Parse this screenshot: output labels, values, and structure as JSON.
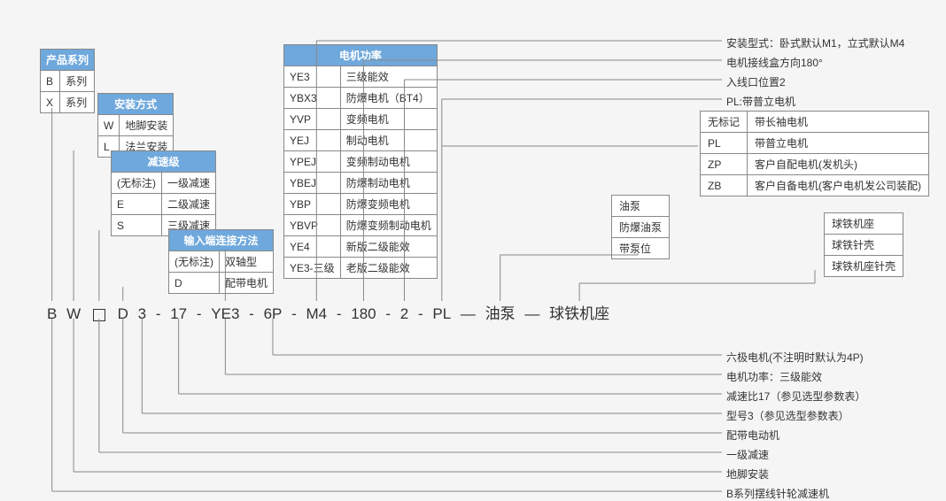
{
  "tables": {
    "series": {
      "title": "产品系列",
      "rows": [
        [
          "B",
          "系列"
        ],
        [
          "X",
          "系列"
        ]
      ]
    },
    "mount": {
      "title": "安装方式",
      "rows": [
        [
          "W",
          "地脚安装"
        ],
        [
          "L",
          "法兰安装"
        ]
      ]
    },
    "reduction": {
      "title": "减速级",
      "rows": [
        [
          "(无标注)",
          "一级减速"
        ],
        [
          "E",
          "二级减速"
        ],
        [
          "S",
          "三级减速"
        ]
      ]
    },
    "input": {
      "title": "输入端连接方法",
      "rows": [
        [
          "(无标注)",
          "双轴型"
        ],
        [
          "D",
          "配带电机"
        ]
      ]
    },
    "motor": {
      "title": "电机功率",
      "rows": [
        [
          "YE3",
          "三级能效"
        ],
        [
          "YBX3",
          "防爆电机（BT4）"
        ],
        [
          "YVP",
          "变频电机"
        ],
        [
          "YEJ",
          "制动电机"
        ],
        [
          "YPEJ",
          "变频制动电机"
        ],
        [
          "YBEJ",
          "防爆制动电机"
        ],
        [
          "YBP",
          "防爆变频电机"
        ],
        [
          "YBVP",
          "防爆变频制动电机"
        ],
        [
          "YE4",
          "新版二级能效"
        ],
        [
          "YE3-三级",
          "老版二级能效"
        ]
      ]
    },
    "motor_mark": {
      "rows": [
        [
          "无标记",
          "带长袖电机"
        ],
        [
          "PL",
          "带普立电机"
        ],
        [
          "ZP",
          "客户自配电机(发机头)"
        ],
        [
          "ZB",
          "客户自备电机(客户电机发公司装配)"
        ]
      ]
    },
    "pump": {
      "rows": [
        [
          "油泵"
        ],
        [
          "防爆油泵"
        ],
        [
          "带泵位"
        ]
      ]
    },
    "iron": {
      "rows": [
        [
          "球铁机座"
        ],
        [
          "球铁针壳"
        ],
        [
          "球铁机座针壳"
        ]
      ]
    }
  },
  "top_notes": [
    "安装型式：卧式默认M1，立式默认M4",
    "电机接线盒方向180°",
    "入线口位置2",
    "PL:带普立电机"
  ],
  "bottom_notes": [
    "六极电机(不注明时默认为4P)",
    "电机功率：三级能效",
    "减速比17（参见选型参数表）",
    "型号3（参见选型参数表）",
    "配带电动机",
    "一级减速",
    "地脚安装",
    "B系列摆线针轮减速机"
  ],
  "code": {
    "p1": "B",
    "p2": "W",
    "p4": "D",
    "p5": "3",
    "p6": "17",
    "p7": "YE3",
    "p8": "6P",
    "p9": "M4",
    "p10": "180",
    "p11": "2",
    "p12": "PL",
    "p13": "油泵",
    "p14": "球铁机座",
    "d": "-",
    "dl": "—"
  }
}
